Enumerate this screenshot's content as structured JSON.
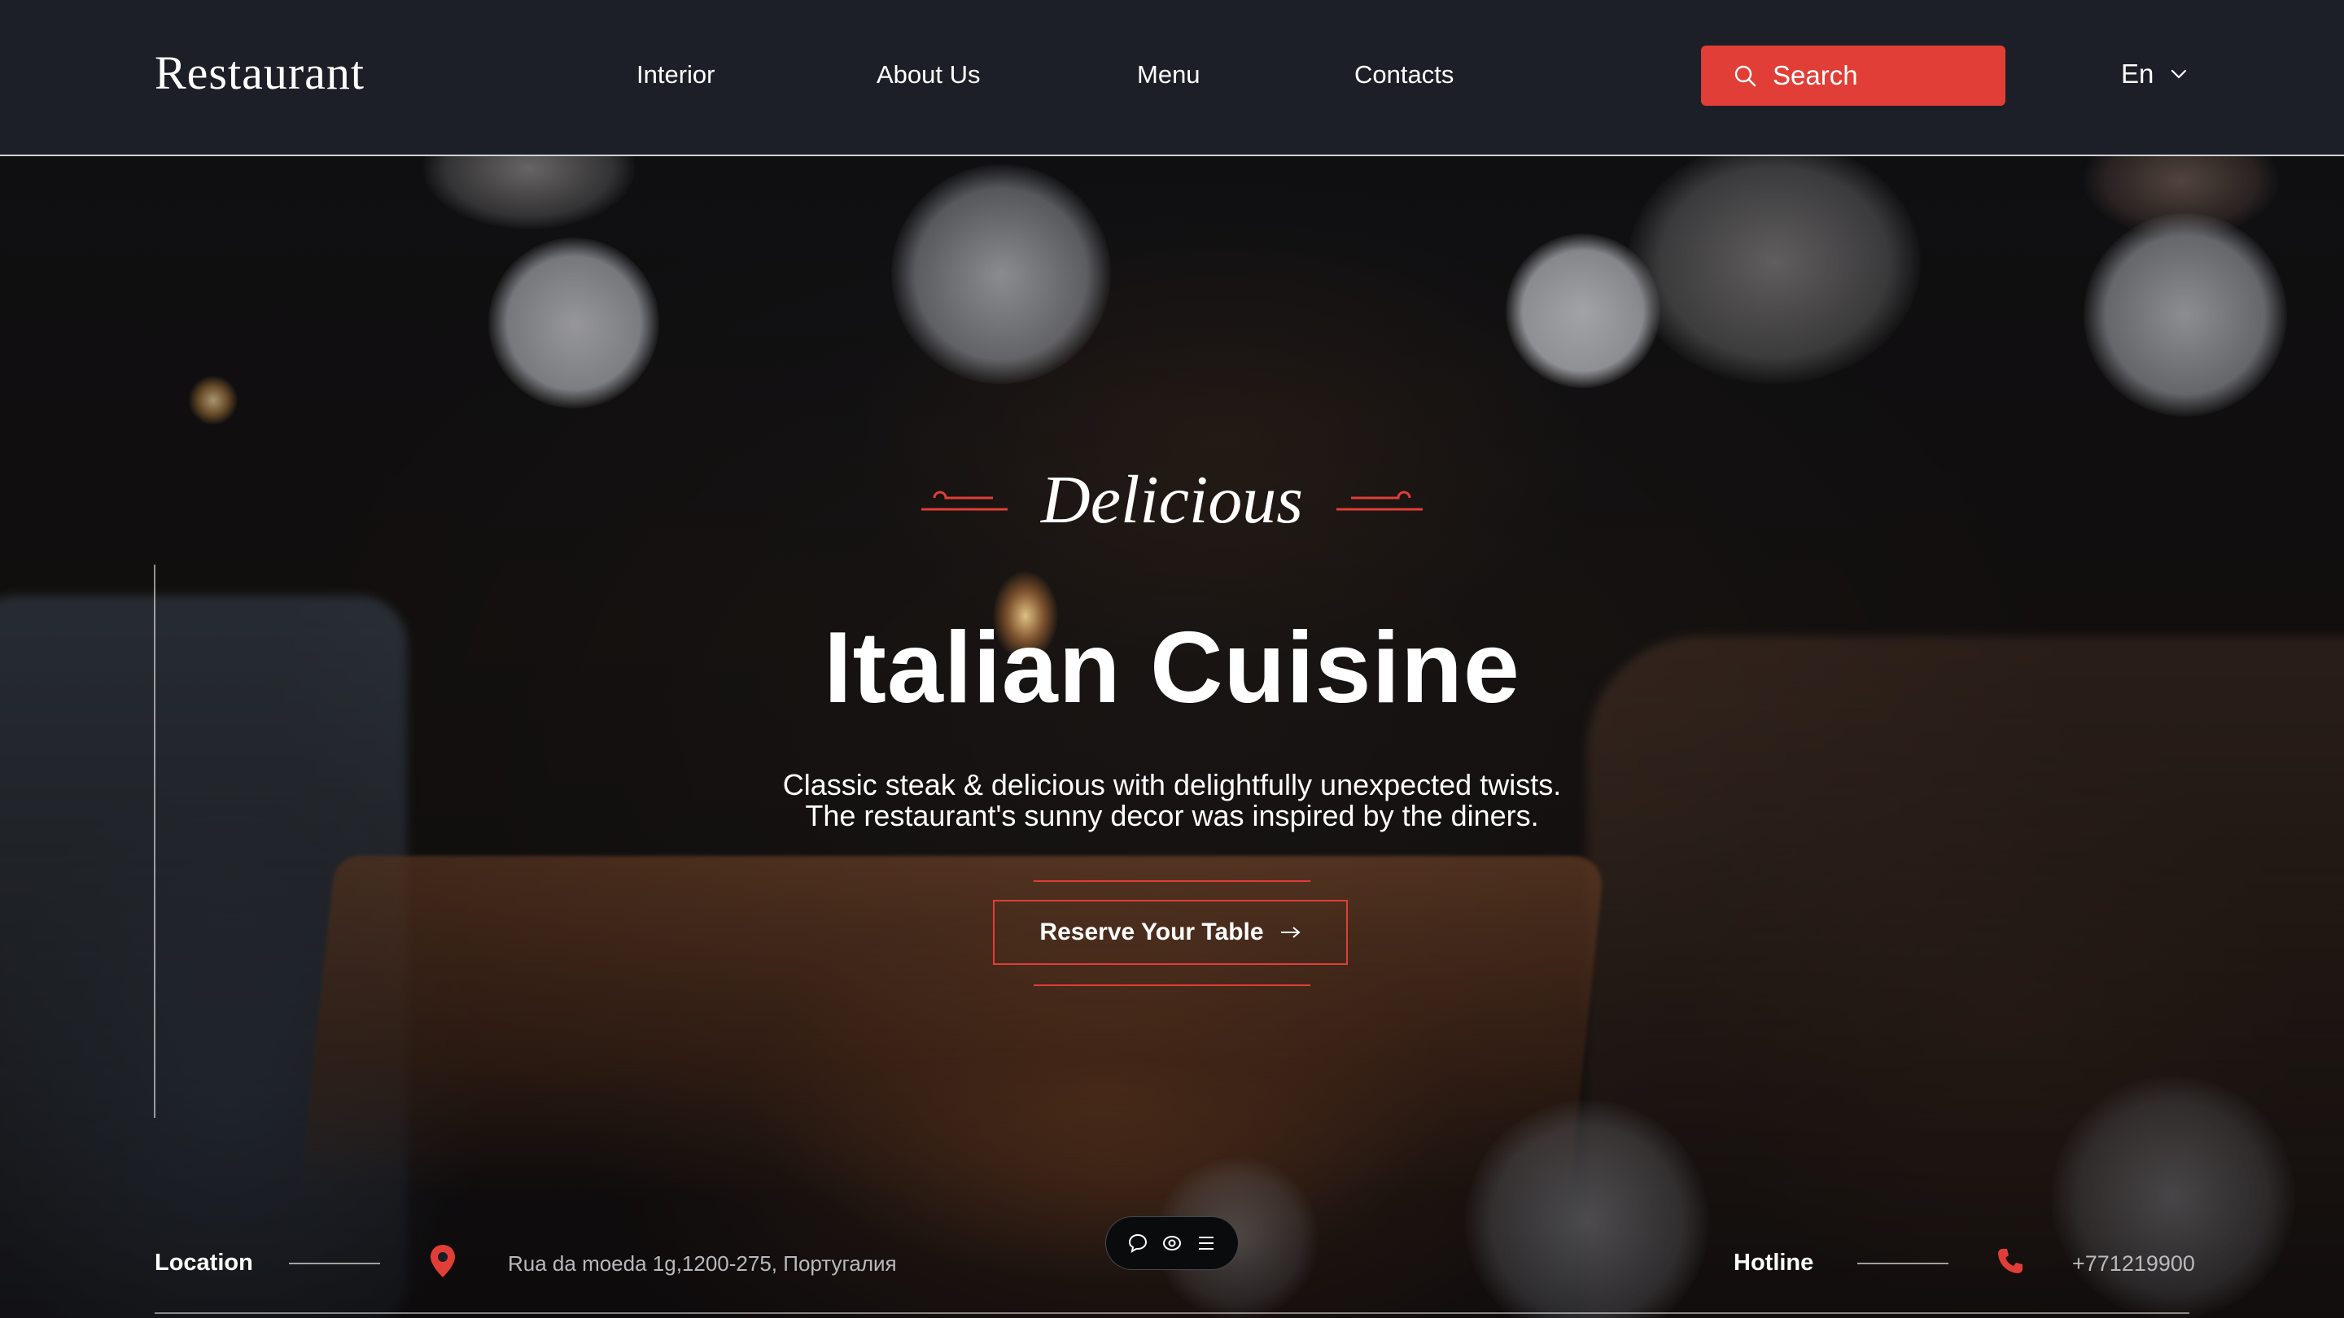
{
  "header": {
    "logo": "Restaurant",
    "nav": [
      {
        "label": "Interior"
      },
      {
        "label": "About Us"
      },
      {
        "label": "Menu"
      },
      {
        "label": "Contacts"
      }
    ],
    "search_label": "Search",
    "language": "En"
  },
  "hero": {
    "script_title": "Delicious",
    "title": "Italian Cuisine",
    "subtitle_line1": "Classic steak & delicious with delightfully unexpected twists.",
    "subtitle_line2": "The restaurant's sunny decor was inspired by the diners.",
    "cta_label": "Reserve Your Table"
  },
  "footer": {
    "location_label": "Location",
    "location_value": "Rua da moeda 1g,1200-275, Португалия",
    "hotline_label": "Hotline",
    "hotline_value": "+771219900"
  },
  "icons": {
    "search": "search-icon",
    "chevron": "chevron-down-icon",
    "arrow": "arrow-right-icon",
    "pin": "map-pin-icon",
    "phone": "phone-icon",
    "chat": "chat-bubble-icon",
    "eye": "eye-icon",
    "menu": "menu-icon"
  },
  "colors": {
    "accent": "#e03e36",
    "header_bg": "#1c1f27",
    "text": "#ffffff",
    "muted_text": "#b9b9bd"
  }
}
